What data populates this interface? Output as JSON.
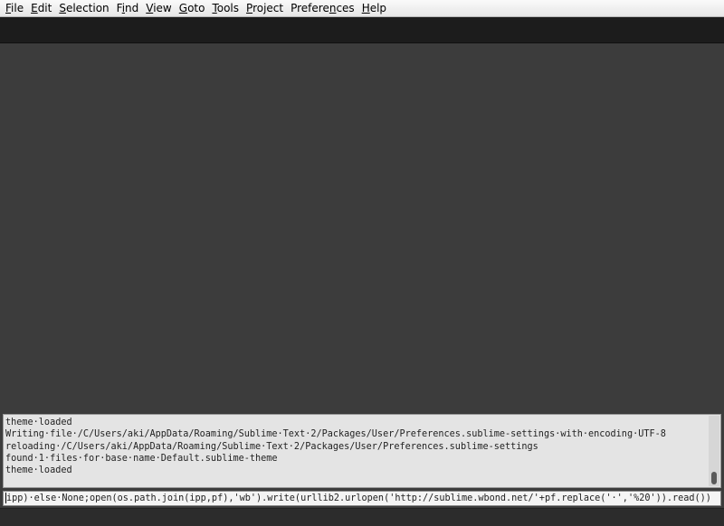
{
  "menu": {
    "items": [
      {
        "accel": "F",
        "rest": "ile"
      },
      {
        "accel": "E",
        "rest": "dit"
      },
      {
        "accel": "S",
        "rest": "election"
      },
      {
        "pre": "F",
        "accel": "i",
        "rest": "nd"
      },
      {
        "accel": "V",
        "rest": "iew"
      },
      {
        "accel": "G",
        "rest": "oto"
      },
      {
        "accel": "T",
        "rest": "ools"
      },
      {
        "accel": "P",
        "rest": "roject"
      },
      {
        "pre": "Prefere",
        "accel": "n",
        "rest": "ces"
      },
      {
        "accel": "H",
        "rest": "elp"
      }
    ]
  },
  "console": {
    "lines": [
      "theme·loaded",
      "Writing·file·/C/Users/aki/AppData/Roaming/Sublime·Text·2/Packages/User/Preferences.sublime-settings·with·encoding·UTF-8",
      "reloading·/C/Users/aki/AppData/Roaming/Sublime·Text·2/Packages/User/Preferences.sublime-settings",
      "found·1·files·for·base·name·Default.sublime-theme",
      "theme·loaded"
    ]
  },
  "input": {
    "value": "ipp)·else·None;open(os.path.join(ipp,pf),'wb').write(urllib2.urlopen('http://sublime.wbond.net/'+pf.replace('·','%20')).read())"
  },
  "colors": {
    "editor_bg": "#3c3c3c",
    "tabbar_bg": "#1c1c1c",
    "console_bg": "#e4e4e4",
    "menubar_bg": "#f0f0f0"
  }
}
